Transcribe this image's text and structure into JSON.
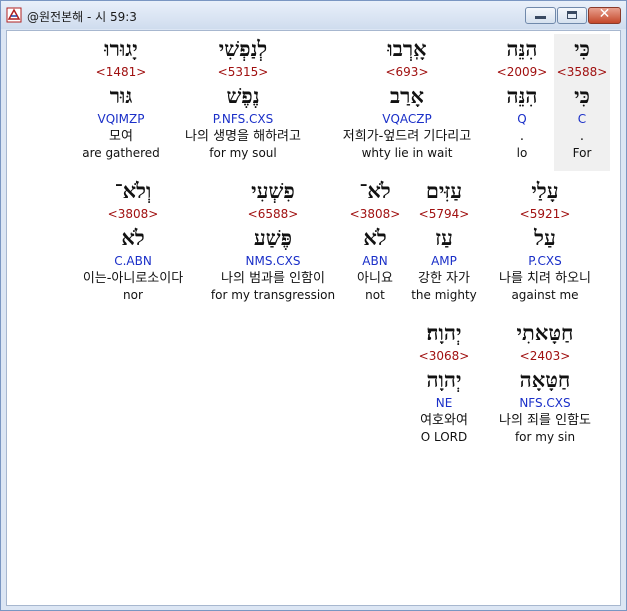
{
  "window": {
    "title": "@원전본해 - 시 59:3"
  },
  "rows": [
    {
      "words": [
        {
          "hebrew": "כִּי",
          "strong": "<3588>",
          "lemma": "כִּי",
          "morph": "C",
          "korean": ".",
          "english": "For"
        },
        {
          "hebrew": "הִנֵּה",
          "strong": "<2009>",
          "lemma": "הִנֵּה",
          "morph": "Q",
          "korean": ".",
          "english": "lo"
        },
        {
          "hebrew": "אָֽרְבוּ",
          "strong": "<693>",
          "lemma": "אָרַב",
          "morph": "VQACZP",
          "korean": "저희가-엎드려 기다리고",
          "english": "whty lie in wait"
        },
        {
          "hebrew": "לְנַפְשִׁי",
          "strong": "<5315>",
          "lemma": "נֶפֶשׁ",
          "morph": "P.NFS.CXS",
          "korean": "나의 생명을 해하려고",
          "english": "for my soul"
        },
        {
          "hebrew": "יָגוּרוּ",
          "strong": "<1481>",
          "lemma": "גּוּר",
          "morph": "VQIMZP",
          "korean": "모여",
          "english": "are gathered"
        }
      ]
    },
    {
      "words": [
        {
          "hebrew": "עָלַי",
          "strong": "<5921>",
          "lemma": "עַל",
          "morph": "P.CXS",
          "korean": "나를 치려 하오니",
          "english": "against me"
        },
        {
          "hebrew": "עַזִּים",
          "strong": "<5794>",
          "lemma": "עַז",
          "morph": "AMP",
          "korean": "강한 자가",
          "english": "the mighty"
        },
        {
          "hebrew": "לֹא־",
          "strong": "<3808>",
          "lemma": "לֹא",
          "morph": "ABN",
          "korean": "아니요",
          "english": "not"
        },
        {
          "hebrew": "פִשְׁעִי",
          "strong": "<6588>",
          "lemma": "פֶּשַׁע",
          "morph": "NMS.CXS",
          "korean": "나의 범과를 인함이",
          "english": "for my transgression"
        },
        {
          "hebrew": "וְלֹא־",
          "strong": "<3808>",
          "lemma": "לֹא",
          "morph": "C.ABN",
          "korean": "이는-아니로소이다",
          "english": "nor"
        }
      ]
    },
    {
      "words": [
        {
          "hebrew": "חַטָּאתִי",
          "strong": "<2403>",
          "lemma": "חַטָּאָה",
          "morph": "NFS.CXS",
          "korean": "나의 죄를 인함도",
          "english": "for my sin"
        },
        {
          "hebrew": "יְהוָה׃",
          "strong": "<3068>",
          "lemma": "יְהוָה",
          "morph": "NE",
          "korean": "여호와여",
          "english": "O LORD"
        }
      ]
    }
  ]
}
